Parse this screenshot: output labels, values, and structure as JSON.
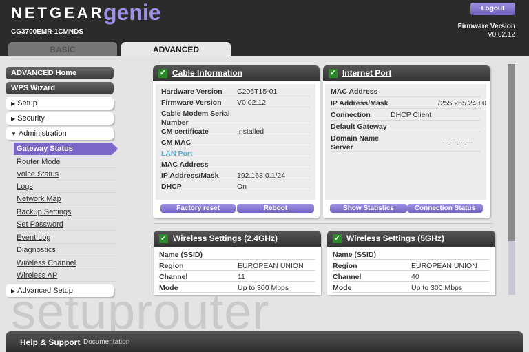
{
  "header": {
    "brand": "NETGEAR",
    "product": "genie",
    "model": "CG3700EMR-1CMNDS",
    "logout": "Logout",
    "firmware_label": "Firmware Version",
    "firmware_value": "V0.02.12"
  },
  "tabs": [
    {
      "label": "BASIC",
      "active": false
    },
    {
      "label": "ADVANCED",
      "active": true
    }
  ],
  "sidebar": {
    "top": [
      "ADVANCED Home",
      "WPS Wizard"
    ],
    "sections": [
      "Setup",
      "Security",
      "Administration"
    ],
    "active": "Gateway Status",
    "sub": [
      "Router Mode",
      "Voice Status",
      "Logs",
      "Network Map",
      "Backup Settings",
      "Set Password",
      "Event Log",
      "Diagnostics",
      "Wireless Channel",
      "Wireless AP"
    ],
    "bottom": "Advanced Setup"
  },
  "cable": {
    "title": "Cable Information",
    "rows": [
      [
        "Hardware Version",
        "C206T15-01"
      ],
      [
        "Firmware Version",
        "V0.02.12"
      ],
      [
        "Cable Modem Serial Number",
        ""
      ],
      [
        "CM certificate",
        "Installed"
      ],
      [
        "CM MAC",
        ""
      ],
      [
        "LAN Port",
        ""
      ],
      [
        "MAC Address",
        ""
      ],
      [
        "IP Address/Mask",
        "192.168.0.1/24"
      ],
      [
        "DHCP",
        "On"
      ]
    ],
    "buttons": [
      "Factory reset",
      "Reboot"
    ]
  },
  "internet": {
    "title": "Internet Port",
    "rows": [
      [
        "MAC Address",
        ""
      ],
      [
        "IP Address/Mask",
        "/255.255.240.0"
      ],
      [
        "Connection",
        "DHCP Client"
      ],
      [
        "Default Gateway",
        ""
      ],
      [
        "Domain Name Server",
        "---.---.---.---"
      ]
    ],
    "buttons": [
      "Show Statistics",
      "Connection Status"
    ]
  },
  "w24": {
    "title": "Wireless Settings (2.4GHz)",
    "rows": [
      [
        "Name (SSID)",
        ""
      ],
      [
        "Region",
        "EUROPEAN UNION"
      ],
      [
        "Channel",
        "11"
      ],
      [
        "Mode",
        "Up to 300 Mbps"
      ]
    ]
  },
  "w5": {
    "title": "Wireless Settings (5GHz)",
    "rows": [
      [
        "Name (SSID)",
        ""
      ],
      [
        "Region",
        "EUROPEAN UNION"
      ],
      [
        "Channel",
        "40"
      ],
      [
        "Mode",
        "Up to 300 Mbps"
      ]
    ]
  },
  "footer": {
    "help": "Help & Support",
    "doc": "Documentation"
  },
  "watermark": "setuprouter",
  "colors": {
    "accent": "#7b68c8",
    "header": "#2b2b2b",
    "lan_port": "#5aaed0"
  }
}
